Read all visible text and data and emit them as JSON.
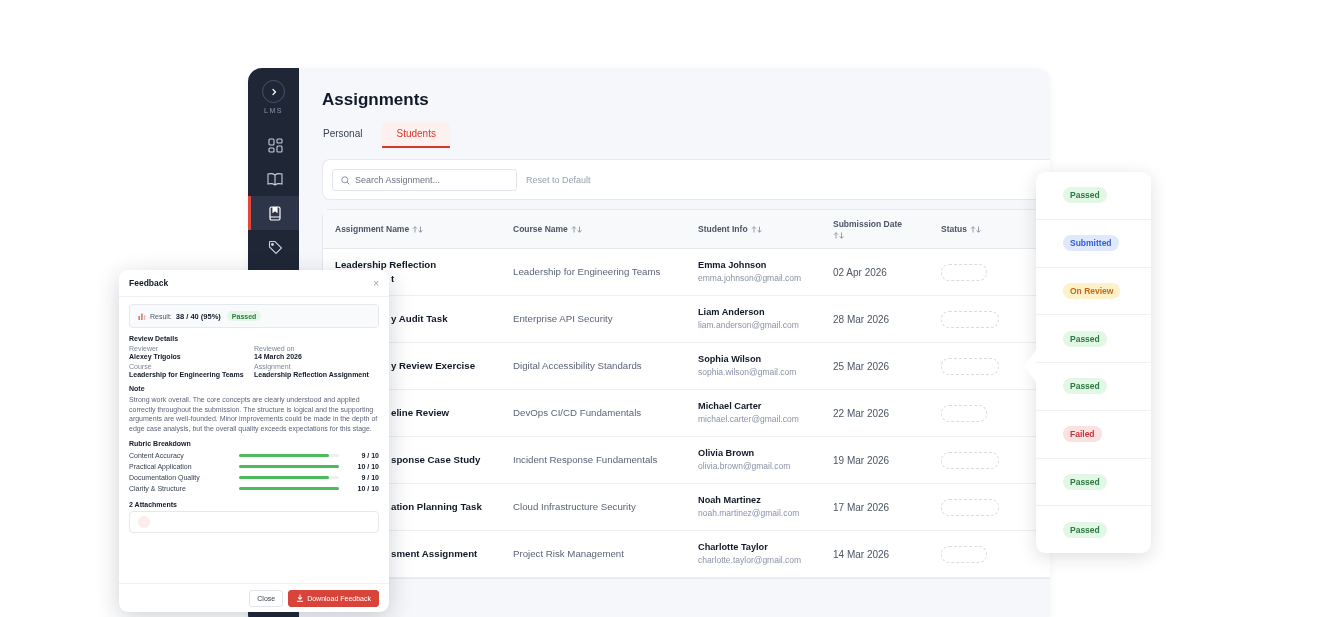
{
  "sidebar": {
    "brand": "LMS",
    "items": [
      {
        "kind": "grid",
        "selected": false
      },
      {
        "kind": "book",
        "selected": false
      },
      {
        "kind": "bookmark",
        "selected": true
      },
      {
        "kind": "tag",
        "selected": false
      }
    ]
  },
  "page": {
    "title": "Assignments",
    "tabs": [
      {
        "label": "Personal",
        "selected": false
      },
      {
        "label": "Students",
        "selected": true
      }
    ],
    "search": {
      "placeholder": "Search Assignment..."
    },
    "reset_button": {
      "label": "Reset to Default",
      "disabled": true
    },
    "table": {
      "columns": [
        "Assignment Name",
        "Course Name",
        "Student Info",
        "Submission Date",
        "Status"
      ],
      "rows": [
        {
          "assignment": [
            "Leadership Reflection",
            "t"
          ],
          "course": "Leadership for Engineering Teams",
          "student": "Emma Johnson",
          "email": "emma.johnson@gmail.com",
          "date": "02 Apr 2026"
        },
        {
          "assignment": [
            "y Audit Task"
          ],
          "course": "Enterprise API Security",
          "student": "Liam Anderson",
          "email": "liam.anderson@gmail.com",
          "date": "28 Mar 2026"
        },
        {
          "assignment": [
            "y Review Exercise"
          ],
          "course": "Digital Accessibility Standards",
          "student": "Sophia Wilson",
          "email": "sophia.wilson@gmail.com",
          "date": "25 Mar 2026"
        },
        {
          "assignment": [
            "eline Review"
          ],
          "course": "DevOps CI/CD Fundamentals",
          "student": "Michael Carter",
          "email": "michael.carter@gmail.com",
          "date": "22 Mar 2026"
        },
        {
          "assignment": [
            "sponse Case Study"
          ],
          "course": "Incident Response Fundamentals",
          "student": "Olivia Brown",
          "email": "olivia.brown@gmail.com",
          "date": "19 Mar 2026"
        },
        {
          "assignment": [
            "ation Planning Task"
          ],
          "course": "Cloud Infrastructure Security",
          "student": "Noah Martinez",
          "email": "noah.martinez@gmail.com",
          "date": "17 Mar 2026"
        },
        {
          "assignment": [
            "sment Assignment"
          ],
          "course": "Project Risk Management",
          "student": "Charlotte Taylor",
          "email": "charlotte.taylor@gmail.com",
          "date": "14 Mar 2026"
        }
      ]
    }
  },
  "status_popup": {
    "items": [
      {
        "label": "Passed",
        "kind": "passed"
      },
      {
        "label": "Submitted",
        "kind": "submitted"
      },
      {
        "label": "On Review",
        "kind": "review"
      },
      {
        "label": "Passed",
        "kind": "passed"
      },
      {
        "label": "Passed",
        "kind": "passed"
      },
      {
        "label": "Failed",
        "kind": "failed"
      },
      {
        "label": "Passed",
        "kind": "passed"
      },
      {
        "label": "Passed",
        "kind": "passed"
      }
    ]
  },
  "feedback": {
    "title": "Feedback",
    "close_icon": "×",
    "result": {
      "label": "Result:",
      "value": "38 / 40 (95%)",
      "badge": "Passed"
    },
    "details_heading": "Review Details",
    "details": [
      {
        "label": "Reviewer",
        "value": "Alexey Trigolos"
      },
      {
        "label": "Reviewed on",
        "value": "14 March 2026"
      },
      {
        "label": "Course",
        "value": "Leadership for Engineering Teams"
      },
      {
        "label": "Assignment",
        "value": "Leadership Reflection Assignment"
      }
    ],
    "note_heading": "Note",
    "note": "Strong work overall. The core concepts are clearly understood and applied correctly throughout the submission. The structure is logical and the supporting arguments are well-founded. Minor improvements could be made in the depth of edge case analysis, but the overall quality exceeds expectations for this stage.",
    "rubric_heading": "Rubric Breakdown",
    "rubric": [
      {
        "name": "Content Accuracy",
        "level": 0.9,
        "score": "9 / 10"
      },
      {
        "name": "Practical Application",
        "level": 1,
        "score": "10 / 10"
      },
      {
        "name": "Documentation Quality",
        "level": 0.9,
        "score": "9 / 10"
      },
      {
        "name": "Clarity & Structure",
        "level": 1,
        "score": "10 / 10"
      }
    ],
    "attachments_heading": "2 Attachments",
    "buttons": [
      {
        "label": "Close",
        "kind": "secondary"
      },
      {
        "label": "Download Feedback",
        "kind": "primary"
      }
    ]
  }
}
